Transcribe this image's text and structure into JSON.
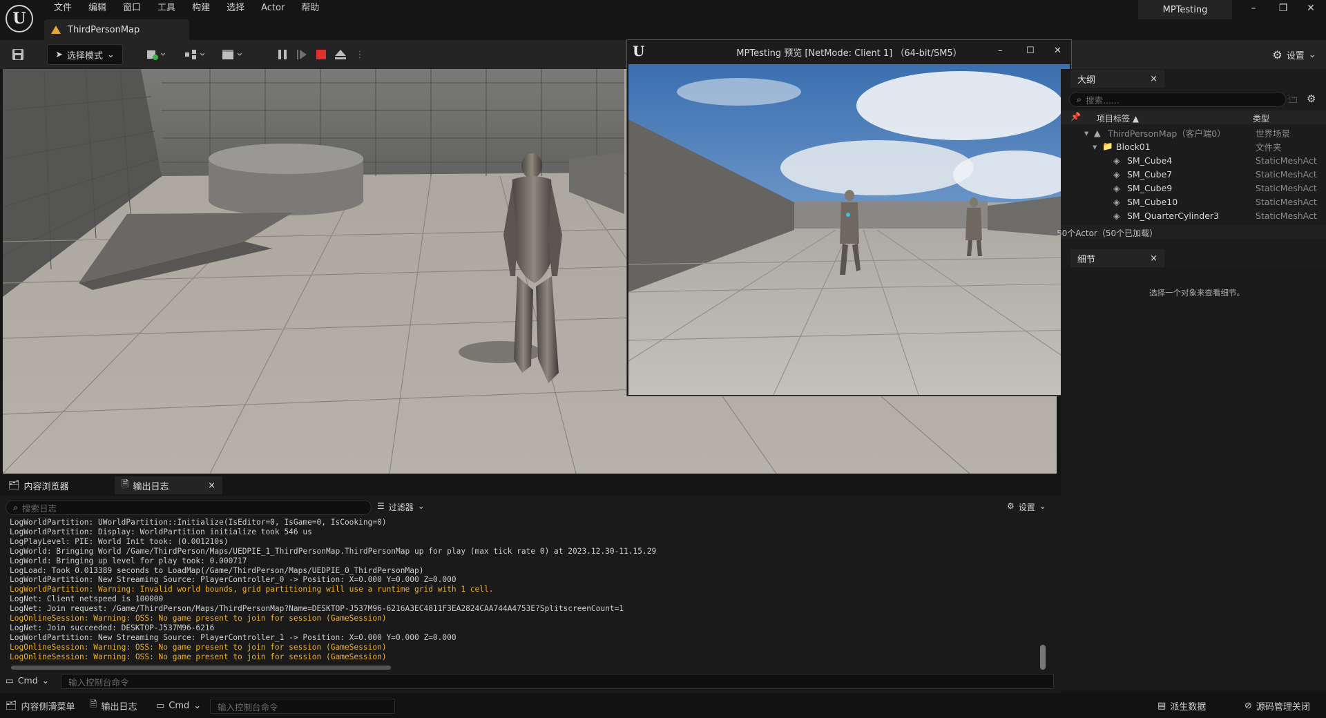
{
  "menu": [
    "文件",
    "编辑",
    "窗口",
    "工具",
    "构建",
    "选择",
    "Actor",
    "帮助"
  ],
  "level_tab": "ThirdPersonMap",
  "project_name": "MPTesting",
  "toolbar": {
    "mode_label": "选择模式",
    "settings_label": "设置"
  },
  "client_window": {
    "title": "MPTesting 预览 [NetMode: Client 1]  （64-bit/SM5）"
  },
  "outliner": {
    "tab_label": "大纲",
    "search_placeholder": "搜索......",
    "col_label": "项目标签 ▲",
    "col_type": "类型",
    "rows": [
      {
        "label": "ThirdPersonMap（客户端0）",
        "type": "世界场景"
      },
      {
        "label": "Block01",
        "type": "文件夹"
      },
      {
        "label": "SM_Cube4",
        "type": "StaticMeshAct"
      },
      {
        "label": "SM_Cube7",
        "type": "StaticMeshAct"
      },
      {
        "label": "SM_Cube9",
        "type": "StaticMeshAct"
      },
      {
        "label": "SM_Cube10",
        "type": "StaticMeshAct"
      },
      {
        "label": "SM_QuarterCylinder3",
        "type": "StaticMeshAct"
      }
    ],
    "status": "50个Actor（50个已加载）"
  },
  "details": {
    "tab_label": "细节",
    "empty_text": "选择一个对象来查看细节。"
  },
  "bottom_tabs": {
    "content_browser": "内容浏览器",
    "output_log": "输出日志"
  },
  "log_panel": {
    "search_placeholder": "搜索日志",
    "filter_label": "过滤器",
    "settings_label": "设置",
    "cmd_label": "Cmd",
    "cmd_placeholder": "输入控制台命令",
    "lines": [
      {
        "text": "LogWorldPartition: UWorldPartition::Initialize(IsEditor=0, IsGame=0, IsCooking=0)",
        "warn": false
      },
      {
        "text": "LogWorldPartition: Display: WorldPartition initialize took 546 us",
        "warn": false
      },
      {
        "text": "LogPlayLevel: PIE: World Init took: (0.001210s)",
        "warn": false
      },
      {
        "text": "LogWorld: Bringing World /Game/ThirdPerson/Maps/UEDPIE_1_ThirdPersonMap.ThirdPersonMap up for play (max tick rate 0) at 2023.12.30-11.15.29",
        "warn": false
      },
      {
        "text": "LogWorld: Bringing up level for play took: 0.000717",
        "warn": false
      },
      {
        "text": "LogLoad: Took 0.013389 seconds to LoadMap(/Game/ThirdPerson/Maps/UEDPIE_0_ThirdPersonMap)",
        "warn": false
      },
      {
        "text": "LogWorldPartition: New Streaming Source: PlayerController_0 -> Position: X=0.000 Y=0.000 Z=0.000",
        "warn": false
      },
      {
        "text": "LogWorldPartition: Warning: Invalid world bounds, grid partitioning will use a runtime grid with 1 cell.",
        "warn": true
      },
      {
        "text": "LogNet: Client netspeed is 100000",
        "warn": false
      },
      {
        "text": "LogNet: Join request: /Game/ThirdPerson/Maps/ThirdPersonMap?Name=DESKTOP-J537M96-6216A3EC4811F3EA2824CAA744A4753E?SplitscreenCount=1",
        "warn": false
      },
      {
        "text": "LogOnlineSession: Warning: OSS: No game present to join for session (GameSession)",
        "warn": true
      },
      {
        "text": "LogNet: Join succeeded: DESKTOP-J537M96-6216",
        "warn": false
      },
      {
        "text": "LogWorldPartition: New Streaming Source: PlayerController_1 -> Position: X=0.000 Y=0.000 Z=0.000",
        "warn": false
      },
      {
        "text": "LogOnlineSession: Warning: OSS: No game present to join for session (GameSession)",
        "warn": true
      },
      {
        "text": "LogOnlineSession: Warning: OSS: No game present to join for session (GameSession)",
        "warn": true
      }
    ]
  },
  "statusbar": {
    "content_drawer": "内容侧滑菜单",
    "output_log": "输出日志",
    "cmd_label": "Cmd",
    "cmd_placeholder": "输入控制台命令",
    "derived_data": "派生数据",
    "source_control": "源码管理关闭"
  },
  "colors": {
    "accent_warning": "#f0b020",
    "stop_red": "#e03030",
    "panel_bg": "#242424"
  }
}
